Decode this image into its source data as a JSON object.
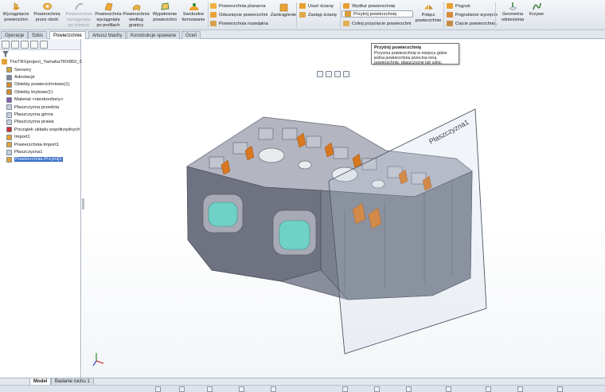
{
  "ribbon": {
    "big_buttons": [
      {
        "label": "Wyciągnięcie powierzchni",
        "lines": [
          "Wyciągnięcie",
          "powierzchni"
        ],
        "icon": "extrude-surface-icon",
        "enabled": true
      },
      {
        "label": "Powierzchnia przez obrót",
        "lines": [
          "Powierzchnia",
          "przez obrót"
        ],
        "icon": "revolve-surface-icon",
        "enabled": true
      },
      {
        "label": "Powierzchnia wyciągnięta po ścieżce",
        "lines": [
          "Powierzchnia",
          "wyciągnięta",
          "po ścieżce"
        ],
        "icon": "sweep-surface-icon",
        "enabled": false
      },
      {
        "label": "Powierzchnia wyciągnięta po profilach",
        "lines": [
          "Powierzchnia",
          "wyciągnięta",
          "po profilach"
        ],
        "icon": "loft-surface-icon",
        "enabled": true
      },
      {
        "label": "Powierzchnia według granicy",
        "lines": [
          "Powierzchnia",
          "według",
          "granicy"
        ],
        "icon": "boundary-surface-icon",
        "enabled": true
      },
      {
        "label": "Wypełnienie powierzchni",
        "lines": [
          "Wypełnienie",
          "powierzchni"
        ],
        "icon": "fill-surface-icon",
        "enabled": true
      },
      {
        "label": "Swobodne formowanie",
        "lines": [
          "Swobodne",
          "formowanie"
        ],
        "icon": "freeform-icon",
        "enabled": true
      }
    ],
    "group2": [
      "Powierzchnia planarna",
      "Odsunięcie powierzchni",
      "Powierzchnia rozwijalna"
    ],
    "zaokraglenie": "Zaokrąglenie",
    "group3": [
      "Usuń ścianę",
      "Zastąp ścianę"
    ],
    "group4": [
      "Wydłuż powierzchnię",
      "Przytnij powierzchnię",
      "Cofnij przycięcie powierzchni"
    ],
    "polacz": [
      "Połącz",
      "powierzchnie"
    ],
    "group5": [
      "Pogrub",
      "Pogrubione wycięcie",
      "Cięcie powierzchnią"
    ],
    "geometria": [
      "Geometria",
      "odniesienia"
    ],
    "krzywe": "Krzywe"
  },
  "tabs": [
    "Operacje",
    "Szkic",
    "Powierzchnie",
    "Arkusz blachy",
    "Konstrukcje spawane",
    "Oceń"
  ],
  "active_tab": "Powierzchnie",
  "tree": {
    "root": "TheTRXproject_YamahaTRX850_Cy",
    "items": [
      {
        "label": "Sensory",
        "icon": "sensor-icon"
      },
      {
        "label": "Adnotacje",
        "icon": "annotation-icon"
      },
      {
        "label": "Obiekty powierzchniowe(1)",
        "icon": "surface-bodies-icon"
      },
      {
        "label": "Obiekty bryłowe(1)",
        "icon": "solid-bodies-icon"
      },
      {
        "label": "Materiał <nieokreślony>",
        "icon": "material-icon"
      },
      {
        "label": "Płaszczyzna przednia",
        "icon": "plane-icon"
      },
      {
        "label": "Płaszczyzna górna",
        "icon": "plane-icon"
      },
      {
        "label": "Płaszczyzna prawa",
        "icon": "plane-icon"
      },
      {
        "label": "Początek układu współrzędnych",
        "icon": "origin-icon"
      },
      {
        "label": "Import1",
        "icon": "import-icon"
      },
      {
        "label": "Powierzchnia-Import1",
        "icon": "surface-import-icon"
      },
      {
        "label": "Płaszczyzna1",
        "icon": "plane-icon"
      },
      {
        "label": "Powierzchnia-Przytnij1",
        "icon": "surface-trim-icon",
        "selected": true
      }
    ]
  },
  "tooltip": {
    "title": "Przytnij powierzchnię",
    "body": "Przycina powierzchnię w miejscu gdzie jedna powierzchnia przecina inną powierzchnię, płaszczyznę lub szkic."
  },
  "plane_label": "Płaszczyzna1",
  "bottom_tabs": [
    "Model",
    "Badanie ruchu 1"
  ],
  "colors": {
    "accent": "#3b6fc9",
    "body": "#8a8e9c",
    "seat": "#6fd1c8",
    "orange": "#d9781e"
  }
}
